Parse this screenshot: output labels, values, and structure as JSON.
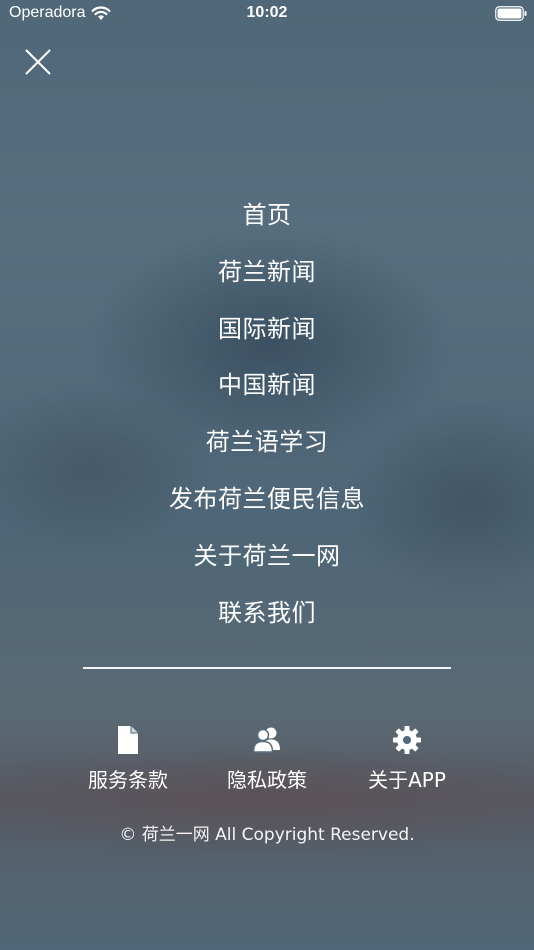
{
  "status_bar": {
    "carrier": "Operadora",
    "time": "10:02"
  },
  "menu": {
    "items": [
      {
        "label": "首页"
      },
      {
        "label": "荷兰新闻"
      },
      {
        "label": "国际新闻"
      },
      {
        "label": "中国新闻"
      },
      {
        "label": "荷兰语学习"
      },
      {
        "label": "发布荷兰便民信息"
      },
      {
        "label": "关于荷兰一网"
      },
      {
        "label": "联系我们"
      }
    ]
  },
  "footer": {
    "links": [
      {
        "label": "服务条款",
        "icon": "document-icon"
      },
      {
        "label": "隐私政策",
        "icon": "users-icon"
      },
      {
        "label": "关于APP",
        "icon": "gear-icon"
      }
    ],
    "copyright": "© 荷兰一网 All Copyright Reserved."
  },
  "colors": {
    "background": "#4f6778",
    "text": "#ffffff",
    "divider": "#f2f4f6"
  }
}
